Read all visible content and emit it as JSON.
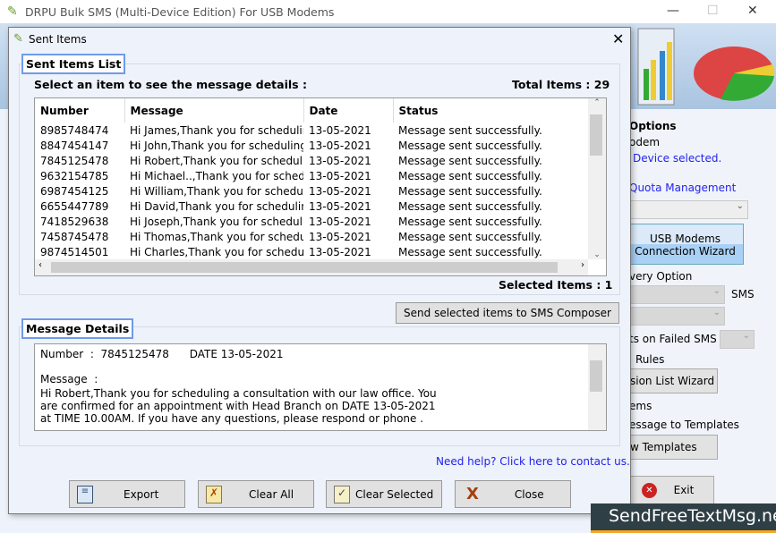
{
  "app": {
    "title": "DRPU Bulk SMS (Multi-Device Edition) For USB Modems",
    "minimize": "—",
    "maximize": "☐",
    "close": "✕"
  },
  "right_panel": {
    "options": "Options",
    "modem": "odem",
    "device": "Device selected.",
    "quota": "Quota Management",
    "usb_wizard_l1": "USB Modems",
    "usb_wizard_l2": "Connection  Wizard",
    "delivery": "very Option",
    "sms": "SMS",
    "failed": "ts on Failed SMS",
    "rules": "Rules",
    "exclusion": "sion List Wizard",
    "items": "ems",
    "save_templates": "essage to Templates",
    "view_templates": "w Templates",
    "exit": "Exit"
  },
  "dialog": {
    "title": "Sent Items",
    "close": "✕",
    "list_group": "Sent Items List",
    "instruction": "Select an item to see the message details :",
    "total": "Total Items : 29",
    "columns": [
      "Number",
      "Message",
      "Date",
      "Status"
    ],
    "rows": [
      [
        "8985748474",
        "Hi James,Thank you for scheduling",
        "13-05-2021",
        "Message sent successfully."
      ],
      [
        "8847454147",
        "Hi John,Thank you for scheduling",
        "13-05-2021",
        "Message sent successfully."
      ],
      [
        "7845125478",
        "Hi Robert,Thank you for scheduling",
        "13-05-2021",
        "Message sent successfully."
      ],
      [
        "9632154785",
        "Hi Michael..,Thank you for schedul",
        "13-05-2021",
        "Message sent successfully."
      ],
      [
        "6987454125",
        "Hi William,Thank you for schedulin",
        "13-05-2021",
        "Message sent successfully."
      ],
      [
        "6655447789",
        "Hi David,Thank you for scheduling",
        "13-05-2021",
        "Message sent successfully."
      ],
      [
        "7418529638",
        "Hi Joseph,Thank you for schedulin",
        "13-05-2021",
        "Message sent successfully."
      ],
      [
        "7458745478",
        "Hi Thomas,Thank you for schedulin",
        "13-05-2021",
        "Message sent successfully."
      ],
      [
        "9874514501",
        "Hi Charles,Thank you for scheduli",
        "13-05-2021",
        "Message sent successfully."
      ]
    ],
    "selected": "Selected Items : 1",
    "send_composer": "Send selected items to SMS Composer",
    "details_group": "Message Details",
    "detail_number_line": "Number  :  7845125478      DATE 13-05-2021",
    "detail_message_label": "Message  :",
    "detail_text": "Hi Robert,Thank you for scheduling a consultation with our law office. You are confirmed for an appointment with Head Branch on DATE 13-05-2021 at TIME 10.00AM. If you have any questions, please respond or phone .",
    "help": "Need help? Click here to contact us.",
    "buttons": {
      "export": "Export",
      "clear_all": "Clear All",
      "clear_selected": "Clear Selected",
      "close": "Close"
    }
  },
  "watermark": "SendFreeTextMsg.net"
}
